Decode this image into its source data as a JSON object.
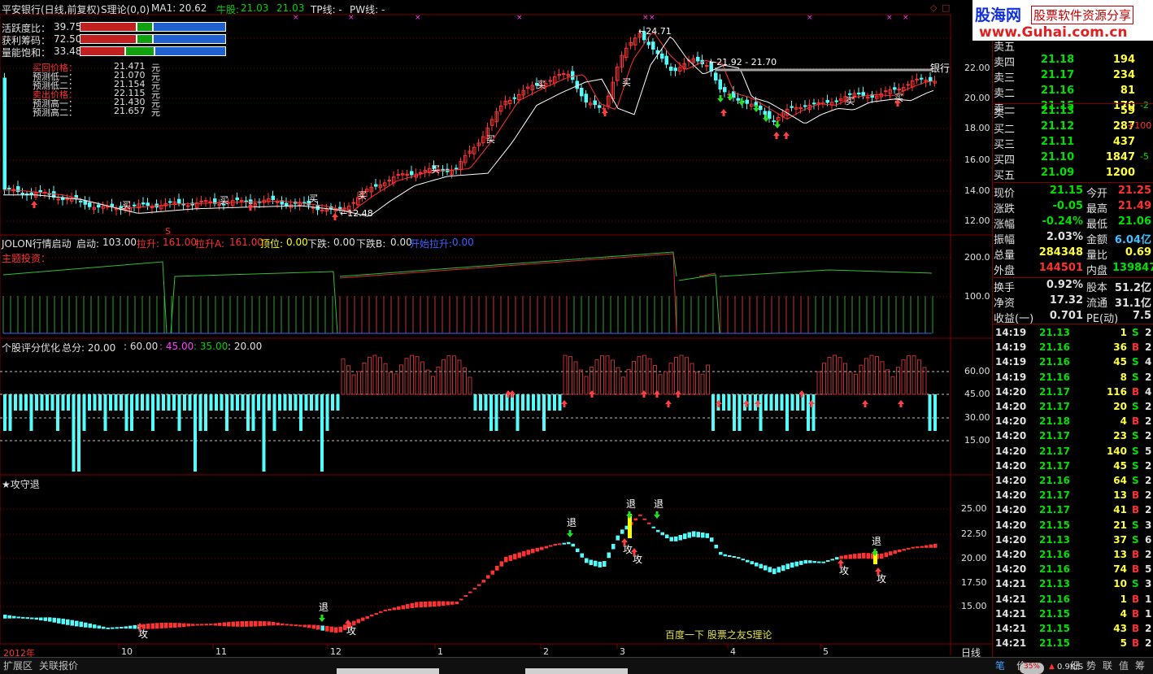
{
  "header": {
    "title": "平安银行(日线,前复权)",
    "theory": "S理论(0,0)",
    "ma1": "MA1: 20.62",
    "niugu_label": "牛股:",
    "niugu_v1": "21.03",
    "niugu_v2": "21.03",
    "tp": "TP线: -",
    "pw": "PW线: -"
  },
  "indicators": [
    {
      "label": "活跃度比：",
      "value": "39.75"
    },
    {
      "label": "获利筹码：",
      "value": "72.50"
    },
    {
      "label": "量能饱和：",
      "value": "33.48"
    }
  ],
  "forecast": [
    {
      "label": "买回价格：",
      "value": "21.471",
      "unit": "元"
    },
    {
      "label": "预测低一：",
      "value": "21.070",
      "unit": "元"
    },
    {
      "label": "预测低二：",
      "value": "21.154",
      "unit": "元"
    },
    {
      "label": "卖出价格：",
      "value": "22.115",
      "unit": "元"
    },
    {
      "label": "预测高一：",
      "value": "21.430",
      "unit": "元"
    },
    {
      "label": "预测高二：",
      "value": "21.657",
      "unit": "元"
    }
  ],
  "main_chart": {
    "y_ticks": [
      "22.00",
      "20.00",
      "18.00",
      "16.00",
      "14.00",
      "12.00"
    ],
    "annotations": {
      "high": "24.71",
      "low": "12.48",
      "range": "21.92 - 21.70",
      "bank": "银行",
      "buy": "买",
      "s": "S"
    }
  },
  "panel2": {
    "items": [
      {
        "label": "JOLON行情启动",
        "value": ""
      },
      {
        "label": "启动:",
        "value": "103.00"
      },
      {
        "label": "拉升:",
        "value": "161.00"
      },
      {
        "label": "拉升A:",
        "value": "161.00"
      },
      {
        "label": "顶位:",
        "value": "0.00"
      },
      {
        "label": "下跌:",
        "value": "0.00"
      },
      {
        "label": "下跌B:",
        "value": "0.00"
      },
      {
        "label": "开始拉升:",
        "value": "0.00"
      }
    ],
    "sub": "主题投资：",
    "y_ticks": [
      "200.0",
      "100.0"
    ]
  },
  "panel3": {
    "title": "个股评分优化",
    "total": "总分: 20.00",
    "v2": ": 60.00",
    "v3": ": 45.00",
    "v4": ": 35.00",
    "v5": ": 20.00",
    "y_ticks": [
      "60.00",
      "45.00",
      "30.00",
      "15.00"
    ]
  },
  "panel4": {
    "title": "★攻守退",
    "y_ticks": [
      "25.00",
      "22.50",
      "20.00",
      "17.50",
      "15.00"
    ],
    "tui": "退",
    "gong": "攻",
    "watermark": "百度一下 股票之友S理论"
  },
  "x_axis": {
    "year": "2012年",
    "months": [
      "10",
      "11",
      "12",
      "1",
      "2",
      "3",
      "4",
      "5"
    ],
    "period": "日线"
  },
  "quote": {
    "sell": [
      {
        "label": "卖五",
        "price": "",
        "vol": ""
      },
      {
        "label": "卖四",
        "price": "21.18",
        "vol": "194"
      },
      {
        "label": "卖三",
        "price": "21.17",
        "vol": "234"
      },
      {
        "label": "卖二",
        "price": "21.16",
        "vol": "81"
      },
      {
        "label": "卖一",
        "price": "21.15",
        "vol": "170",
        "chg": "-2"
      }
    ],
    "buy": [
      {
        "label": "买一",
        "price": "21.13",
        "vol": "59",
        "chg": ""
      },
      {
        "label": "买二",
        "price": "21.12",
        "vol": "287",
        "chg": "+100"
      },
      {
        "label": "买三",
        "price": "21.11",
        "vol": "437",
        "chg": ""
      },
      {
        "label": "买四",
        "price": "21.10",
        "vol": "1847",
        "chg": "-5"
      },
      {
        "label": "买五",
        "price": "21.09",
        "vol": "1200",
        "chg": ""
      }
    ],
    "stats": [
      {
        "l1": "现价",
        "v1": "21.15",
        "l2": "今开",
        "v2": "21.25"
      },
      {
        "l1": "涨跌",
        "v1": "-0.05",
        "l2": "最高",
        "v2": "21.49"
      },
      {
        "l1": "涨幅",
        "v1": "-0.24%",
        "l2": "最低",
        "v2": "21.06"
      },
      {
        "l1": "振幅",
        "v1": "2.03%",
        "l2": "金额",
        "v2": "6.04亿"
      },
      {
        "l1": "总量",
        "v1": "284348",
        "l2": "量比",
        "v2": "0.69"
      },
      {
        "l1": "外盘",
        "v1": "144501",
        "l2": "内盘",
        "v2": "139847"
      },
      {
        "l1": "换手",
        "v1": "0.92%",
        "l2": "股本",
        "v2": "51.2亿"
      },
      {
        "l1": "净资",
        "v1": "17.32",
        "l2": "流通",
        "v2": "31.1亿"
      },
      {
        "l1": "收益(一)",
        "v1": "0.701",
        "l2": "PE(动)",
        "v2": "7.5"
      }
    ]
  },
  "ticks": [
    [
      "14:19",
      "21.13",
      "1",
      "S",
      "2"
    ],
    [
      "14:19",
      "21.16",
      "36",
      "B",
      "2"
    ],
    [
      "14:19",
      "21.16",
      "45",
      "S",
      "4"
    ],
    [
      "14:19",
      "21.16",
      "8",
      "S",
      "2"
    ],
    [
      "14:20",
      "21.17",
      "116",
      "B",
      "4"
    ],
    [
      "14:20",
      "21.17",
      "20",
      "S",
      "2"
    ],
    [
      "14:20",
      "21.18",
      "4",
      "B",
      "2"
    ],
    [
      "14:20",
      "21.17",
      "23",
      "S",
      "2"
    ],
    [
      "14:20",
      "21.17",
      "140",
      "S",
      "5"
    ],
    [
      "14:20",
      "21.17",
      "45",
      "S",
      "2"
    ],
    [
      "14:20",
      "21.16",
      "64",
      "S",
      "2"
    ],
    [
      "14:20",
      "21.17",
      "13",
      "B",
      "2"
    ],
    [
      "14:20",
      "21.17",
      "41",
      "B",
      "2"
    ],
    [
      "14:20",
      "21.15",
      "21",
      "S",
      "3"
    ],
    [
      "14:20",
      "21.13",
      "37",
      "S",
      "6"
    ],
    [
      "14:20",
      "21.16",
      "13",
      "B",
      "2"
    ],
    [
      "14:20",
      "21.16",
      "74",
      "B",
      "5"
    ],
    [
      "14:21",
      "21.13",
      "10",
      "S",
      "3"
    ],
    [
      "14:21",
      "21.16",
      "1",
      "B",
      "1"
    ],
    [
      "14:21",
      "21.15",
      "4",
      "B",
      "1"
    ],
    [
      "14:21",
      "21.15",
      "43",
      "B",
      "2"
    ],
    [
      "14:21",
      "21.15",
      "5",
      "B",
      "2"
    ]
  ],
  "brand": {
    "name": "股海网",
    "tagline": "股票软件资源分享",
    "url": "www.Guhai.com.cn"
  },
  "bottom": {
    "tab1": "扩展区",
    "tab2": "关联报价",
    "side_tabs": [
      "笔",
      "价",
      "细",
      "势",
      "联",
      "值",
      "筹"
    ],
    "speed": "0.9K/S",
    "pct": "35%"
  },
  "colors": {
    "up": "#ff3232",
    "down": "#54fcfc",
    "ma": "#ffffff",
    "grid": "#800000",
    "yellow": "#ffff00"
  }
}
